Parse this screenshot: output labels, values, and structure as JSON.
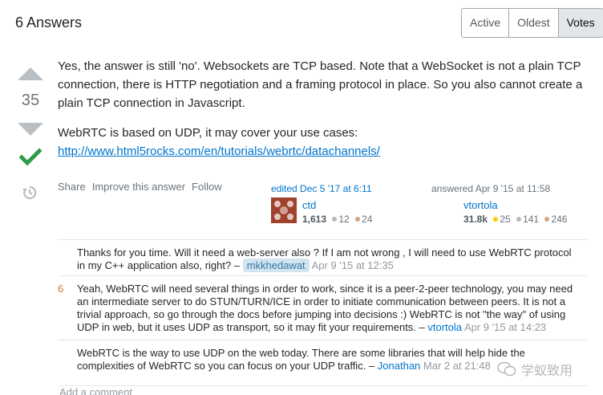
{
  "header": {
    "title": "6 Answers",
    "sort_tabs": [
      "Active",
      "Oldest",
      "Votes"
    ],
    "active_sort": "Votes"
  },
  "votes": {
    "count": "35"
  },
  "post": {
    "p1": "Yes, the answer is still 'no'. Websockets are TCP based. Note that a WebSocket is not a plain TCP connection, there is HTTP negotiation and a framing protocol in place. So you also cannot create a plain TCP connection in Javascript.",
    "p2": "WebRTC is based on UDP, it may cover your use cases:",
    "link": "http://www.html5rocks.com/en/tutorials/webrtc/datachannels/"
  },
  "menu": {
    "share": "Share",
    "improve": "Improve this answer",
    "follow": "Follow"
  },
  "editor": {
    "action": "edited Dec 5 '17 at 6:11",
    "name": "ctd",
    "rep": "1,613",
    "silver": "12",
    "bronze": "24"
  },
  "author": {
    "action": "answered Apr 9 '15 at 11:58",
    "name": "vtortola",
    "rep": "31.8k",
    "gold": "25",
    "silver": "141",
    "bronze": "246"
  },
  "comments": [
    {
      "score": "",
      "text": "Thanks for you time. Will it need a web-server also ? If I am not wrong , I will need to use WebRTC protocol in my C++ application also, right? –",
      "user": "mkkhedawat",
      "date": "Apr 9 '15 at 12:35"
    },
    {
      "score": "6",
      "text": "Yeah, WebRTC will need several things in order to work, since it is a peer-2-peer technology, you may need an intermediate server to do STUN/TURN/ICE in order to initiate communication between peers. It is not a trivial approach, so go through the docs before jumping into decisions :) WebRTC is not \"the way\" of using UDP in web, but it uses UDP as transport, so it may fit your requirements. –",
      "user": "vtortola",
      "date": "Apr 9 '15 at 14:23"
    },
    {
      "score": "",
      "text": "WebRTC is the way to use UDP on the web today. There are some libraries that will help hide the complexities of WebRTC so you can focus on your UDP traffic. –",
      "user": "Jonathan",
      "date": "Mar 2 at 21:48"
    }
  ],
  "add_comment": "Add a comment",
  "watermark": "学蚁致用",
  "colors": {
    "link": "#0074cc",
    "accepted": "#2f9a48",
    "score": "#cc7b2f"
  },
  "icons": {
    "upvote": "triangle-up-icon",
    "downvote": "triangle-down-icon",
    "accepted": "checkmark-icon",
    "history": "history-icon"
  }
}
